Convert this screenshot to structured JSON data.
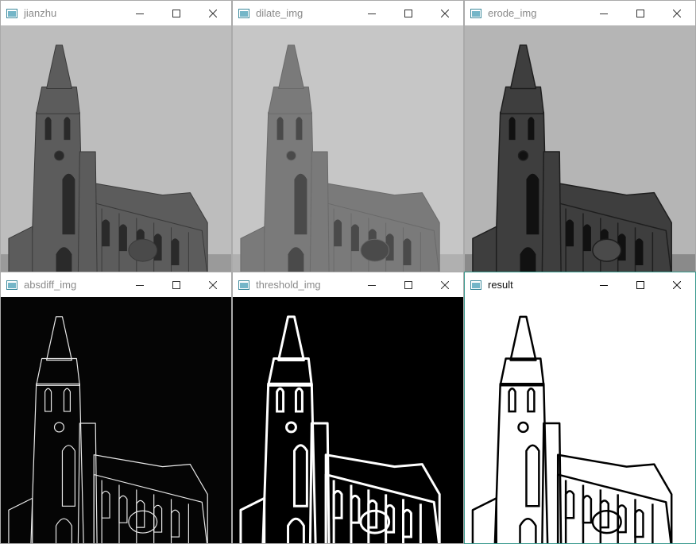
{
  "windows": [
    {
      "id": "jianzhu",
      "title": "jianzhu",
      "view": "original"
    },
    {
      "id": "dilate",
      "title": "dilate_img",
      "view": "dilate"
    },
    {
      "id": "erode",
      "title": "erode_img",
      "view": "erode"
    },
    {
      "id": "absdiff",
      "title": "absdiff_img",
      "view": "absdiff"
    },
    {
      "id": "threshold",
      "title": "threshold_img",
      "view": "threshold"
    },
    {
      "id": "result",
      "title": "result",
      "view": "result",
      "active": true
    }
  ],
  "controls": {
    "minimize": "minimize-icon",
    "maximize": "maximize-icon",
    "close": "close-icon"
  },
  "colors": {
    "active_border": "#3a9a8e",
    "title_inactive": "#8a8a8a",
    "title_active": "#111111"
  }
}
